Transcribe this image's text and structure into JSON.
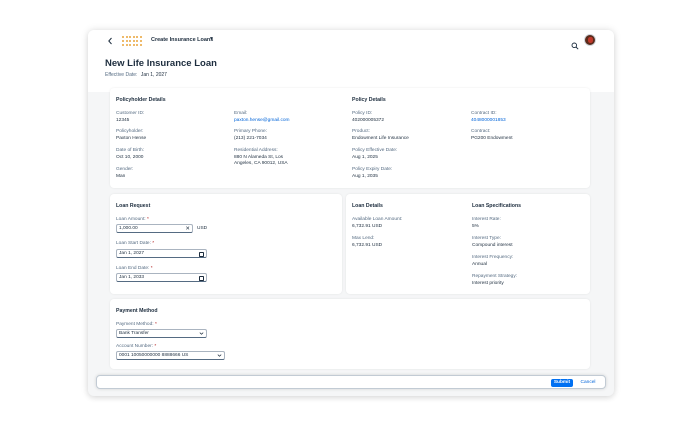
{
  "shell": {
    "back_icon": "chevron-left-icon",
    "app_title": "Create Insurance Loans",
    "title_chevron": "▼",
    "search_icon": "search-icon"
  },
  "page": {
    "title": "New Life Insurance Loan",
    "effective_date_label": "Effective Date:",
    "effective_date_value": "Jan 1, 2027"
  },
  "policyholder": {
    "title": "Policyholder Details",
    "customer_id_label": "Customer ID:",
    "customer_id": "12345",
    "policyholder_label": "Policyholder:",
    "policyholder": "Paxton Hense",
    "dob_label": "Date of Birth:",
    "dob": "Oct 10, 2000",
    "gender_label": "Gender:",
    "gender": "Man",
    "email_label": "Email:",
    "email": "paxton.hense@gmail.com",
    "phone_label": "Primary Phone:",
    "phone": "(213) 221-7034",
    "address_label": "Residential Address:",
    "address_line1": "880 N Alameda St, Los",
    "address_line2": "Angeles, CA 90012, USA"
  },
  "policy": {
    "title": "Policy Details",
    "policy_id_label": "Policy ID:",
    "policy_id": "402000005372",
    "product_label": "Product:",
    "product": "Endowment Life Insurance",
    "effective_label": "Policy Effective Date:",
    "effective": "Aug 1, 2025",
    "expiry_label": "Policy Expiry Date:",
    "expiry": "Aug 1, 2035",
    "contract_id_label": "Contract ID:",
    "contract_id": "4048000001853",
    "contract_label": "Contract:",
    "contract": "PG200 Endowment"
  },
  "loan_request": {
    "title": "Loan Request",
    "amount_label": "Loan Amount:",
    "amount_value": "1,000.00",
    "amount_unit": "USD",
    "clear_icon": "✕",
    "start_label": "Loan Start Date:",
    "start_value": "Jan 1, 2027",
    "end_label": "Loan End Date:",
    "end_value": "Jan 1, 2033",
    "required_mark": "*"
  },
  "loan_details": {
    "title": "Loan Details",
    "available_label": "Available Loan Amount:",
    "available": "6,732.91 USD",
    "max_label": "Max Lend:",
    "max": "6,732.91 USD"
  },
  "loan_specs": {
    "title": "Loan Specifications",
    "rate_label": "Interest Rate:",
    "rate": "5%",
    "type_label": "Interest Type:",
    "type": "Compound interest",
    "frequency_label": "Interest Frequency:",
    "frequency": "Annual",
    "strategy_label": "Repayment Strategy:",
    "strategy": "Interest priority"
  },
  "payment": {
    "title": "Payment Method",
    "method_label": "Payment Method:",
    "method_value": "Bank Transfer",
    "account_label": "Account Number:",
    "account_value": "0001 10050000000 8888666 US"
  },
  "footer": {
    "submit_label": "Submit",
    "cancel_label": "Cancel"
  },
  "colors": {
    "accent": "#0070f2",
    "link": "#0064d9",
    "logo": "#e9a53b",
    "required": "#aa0808"
  }
}
